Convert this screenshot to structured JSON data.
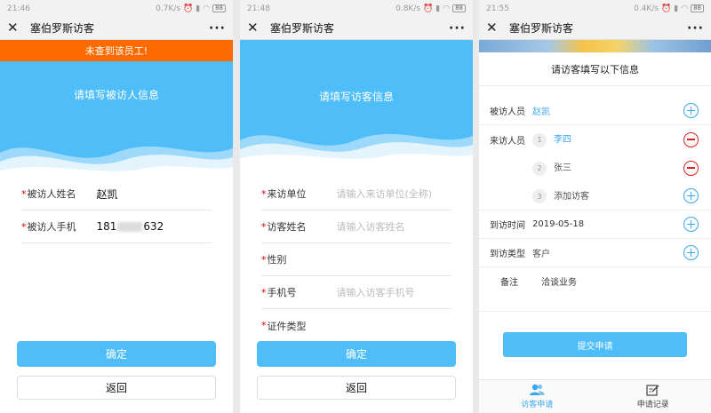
{
  "common": {
    "app_title": "塞伯罗斯访客",
    "more": "···",
    "close": "✕",
    "battery": "88"
  },
  "screen1": {
    "time": "21:46",
    "speed": "0.7K/s",
    "error": "未查到该员工!",
    "hero": "请填写被访人信息",
    "fields": [
      {
        "label": "被访人姓名",
        "value": "赵凯"
      },
      {
        "label": "被访人手机",
        "value_prefix": "181",
        "value_suffix": "632"
      }
    ],
    "confirm": "确定",
    "back": "返回"
  },
  "screen2": {
    "time": "21:48",
    "speed": "0.8K/s",
    "hero": "请填写访客信息",
    "fields": [
      {
        "label": "来访单位",
        "placeholder": "请输入来访单位(全称)"
      },
      {
        "label": "访客姓名",
        "placeholder": "请输入访客姓名"
      },
      {
        "label": "性别",
        "placeholder": ""
      },
      {
        "label": "手机号",
        "placeholder": "请输入访客手机号"
      },
      {
        "label": "证件类型",
        "placeholder": ""
      }
    ],
    "confirm": "确定",
    "back": "返回"
  },
  "screen3": {
    "time": "21:55",
    "speed": "0.4K/s",
    "heading": "请访客填写以下信息",
    "host_label": "被访人员",
    "host_value": "赵凯",
    "visitor_label": "来访人员",
    "visitors": [
      {
        "num": "1",
        "name": "李四"
      },
      {
        "num": "2",
        "name": "张三"
      },
      {
        "num": "3",
        "name": "添加访客"
      }
    ],
    "time_label": "到访时间",
    "time_value": "2019-05-18",
    "type_label": "到访类型",
    "type_value": "客户",
    "note_label": "备注",
    "note_value": "洽谈业务",
    "submit": "提交申请",
    "tabs": [
      {
        "label": "访客申请",
        "icon": "users-icon"
      },
      {
        "label": "申请记录",
        "icon": "edit-icon"
      }
    ]
  }
}
